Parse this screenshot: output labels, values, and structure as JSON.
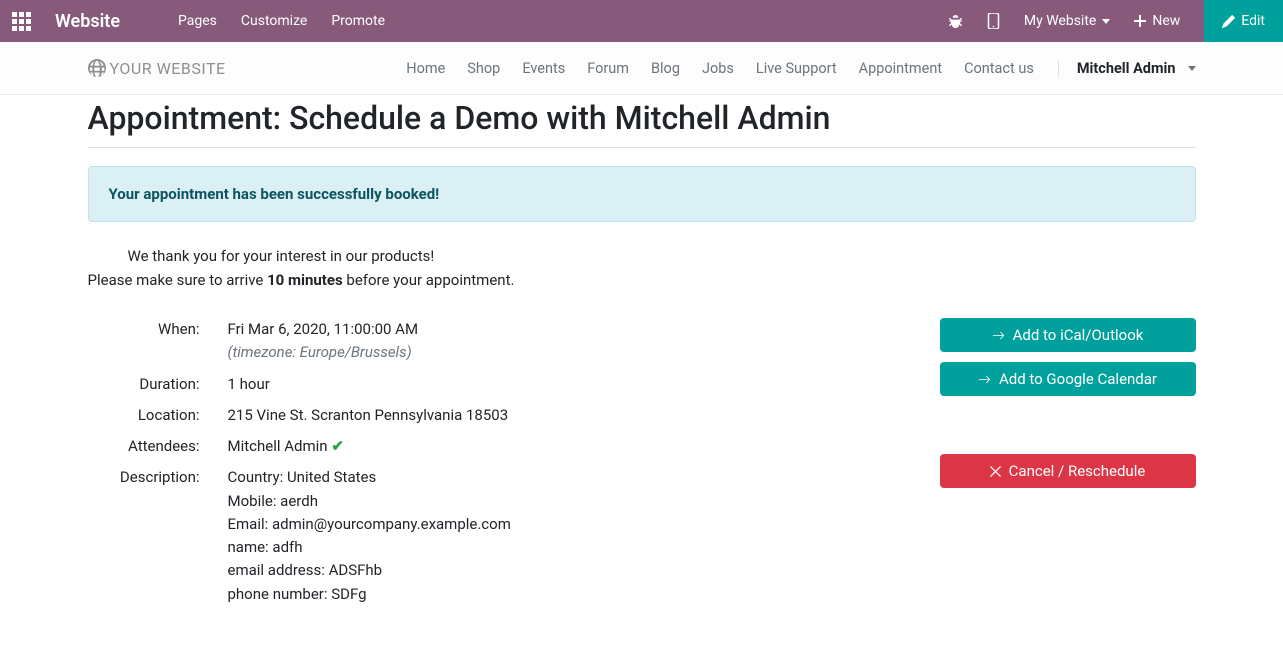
{
  "topbar": {
    "brand": "Website",
    "menu": [
      "Pages",
      "Customize",
      "Promote"
    ],
    "my_website": "My Website",
    "new_label": "New",
    "edit_label": "Edit"
  },
  "sitenav": {
    "logo_text": "YOUR WEBSITE",
    "items": [
      "Home",
      "Shop",
      "Events",
      "Forum",
      "Blog",
      "Jobs",
      "Live Support",
      "Appointment",
      "Contact us"
    ],
    "user": "Mitchell Admin"
  },
  "page": {
    "title": "Appointment: Schedule a Demo with Mitchell Admin",
    "alert": "Your appointment has been successfully booked!",
    "thanks_line1": "We thank you for your interest in our products!",
    "thanks_line2a": "Please make sure to arrive ",
    "thanks_line2b": "10 minutes",
    "thanks_line2c": " before your appointment."
  },
  "details": {
    "labels": {
      "when": "When:",
      "duration": "Duration:",
      "location": "Location:",
      "attendees": "Attendees:",
      "description": "Description:"
    },
    "when_value": "Fri Mar 6, 2020, 11:00:00 AM",
    "when_tz": "(timezone: Europe/Brussels)",
    "duration_value": "1 hour",
    "location_value": "215 Vine St. Scranton Pennsylvania 18503",
    "attendee_name": "Mitchell Admin",
    "description_lines": [
      "Country: United States",
      "Mobile: aerdh",
      "Email: admin@yourcompany.example.com",
      "name: adfh",
      "email address: ADSFhb",
      "phone number: SDFg"
    ]
  },
  "actions": {
    "ical": "Add to iCal/Outlook",
    "gcal": "Add to Google Calendar",
    "cancel": "Cancel / Reschedule"
  }
}
